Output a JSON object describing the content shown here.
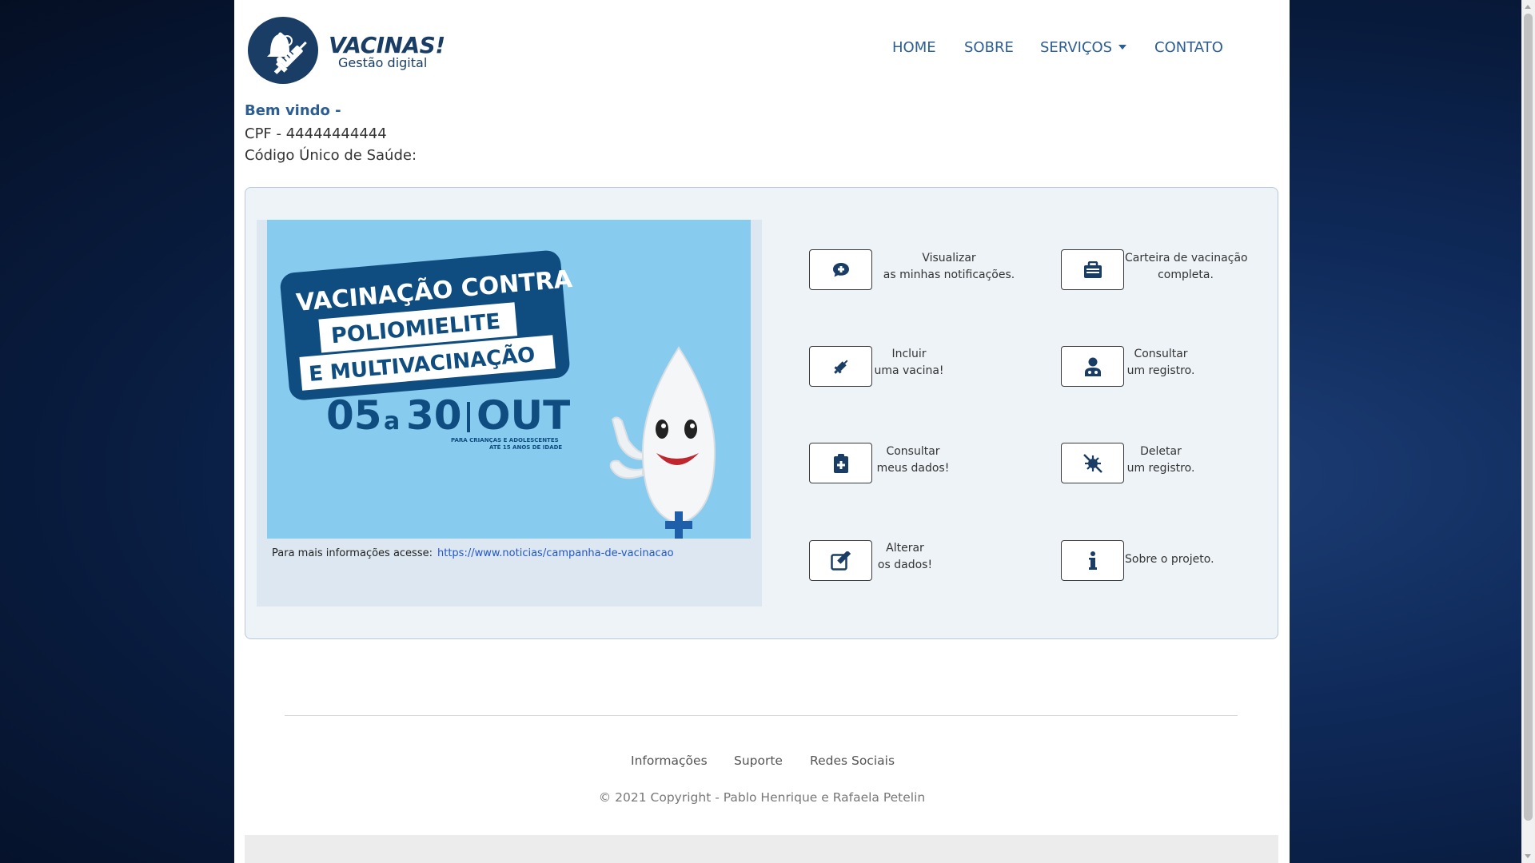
{
  "header": {
    "logo_title": "VACINAS!",
    "logo_subtitle": "Gestão digital",
    "nav": {
      "home": "HOME",
      "sobre": "SOBRE",
      "servicos": "SERVIÇOS",
      "contato": "CONTATO"
    }
  },
  "welcome": {
    "greeting": "Bem vindo -",
    "cpf": "CPF - 44444444444",
    "codigo": "Código Único de Saúde:"
  },
  "ad": {
    "line1": "VACINAÇÃO CONTRA",
    "line2": "POLIOMIELITE",
    "line3": "E MULTIVACINAÇÃO",
    "dates_a": "05",
    "dates_b": "a",
    "dates_c": "30",
    "dates_d": "OUT",
    "small1": "PARA CRIANÇAS E ADOLESCENTES",
    "small2": "ATÉ 15 ANOS DE IDADE",
    "caption": "Para mais informações acesse:",
    "link": "https://www.noticias/campanha-de-vacinacao"
  },
  "actions": {
    "notif_l1": "Visualizar",
    "notif_l2": "as minhas notificações.",
    "carteira_l1": "Carteira de vacinação",
    "carteira_l2": "completa.",
    "incluir_l1": "Incluir",
    "incluir_l2": "uma vacina!",
    "consultar_reg_l1": "Consultar",
    "consultar_reg_l2": "um registro.",
    "consultar_dados_l1": "Consultar",
    "consultar_dados_l2": "meus dados!",
    "deletar_l1": "Deletar",
    "deletar_l2": "um registro.",
    "alterar_l1": "Alterar",
    "alterar_l2": "os dados!",
    "sobre": "Sobre o projeto."
  },
  "footer": {
    "informacoes": "Informações",
    "suporte": "Suporte",
    "redes": "Redes Sociais",
    "copyright": "© 2021 Copyright - Pablo Henrique e Rafaela Petelin"
  },
  "colors": {
    "brand": "#1a3d66",
    "nav": "#2c5d93",
    "link": "#2157c9",
    "ad_background": "#87cbee"
  }
}
